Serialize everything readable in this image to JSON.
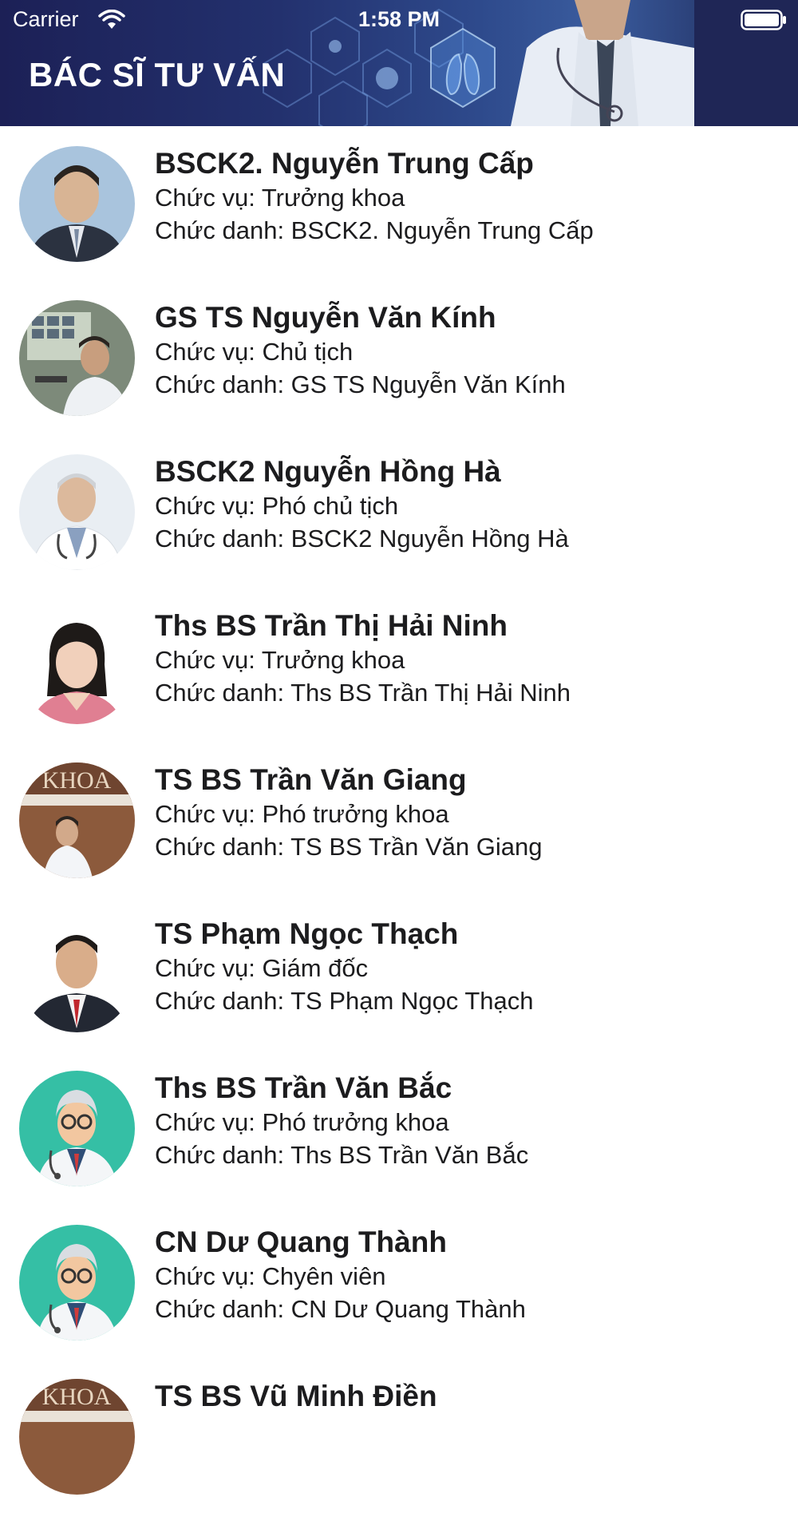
{
  "status_bar": {
    "carrier": "Carrier",
    "time": "1:58 PM"
  },
  "header": {
    "title": "BÁC SĨ TƯ VẤN"
  },
  "doctors": [
    {
      "name": "BSCK2. Nguyễn Trung Cấp",
      "position": "Chức vụ: Trưởng khoa",
      "title": "Chức danh: BSCK2. Nguyễn Trung Cấp"
    },
    {
      "name": "GS TS Nguyễn Văn Kính",
      "position": "Chức vụ: Chủ tịch",
      "title": "Chức danh: GS TS Nguyễn Văn Kính"
    },
    {
      "name": "BSCK2 Nguyễn Hồng Hà",
      "position": "Chức vụ: Phó chủ tịch",
      "title": "Chức danh: BSCK2 Nguyễn Hồng Hà"
    },
    {
      "name": "Ths BS Trần Thị Hải Ninh",
      "position": "Chức vụ: Trưởng khoa",
      "title": "Chức danh: Ths BS Trần Thị Hải Ninh"
    },
    {
      "name": "TS BS Trần Văn Giang",
      "position": "Chức vụ: Phó trưởng khoa",
      "title": "Chức danh: TS BS Trần Văn Giang"
    },
    {
      "name": "TS Phạm Ngọc Thạch",
      "position": "Chức vụ: Giám đốc",
      "title": "Chức danh: TS Phạm Ngọc Thạch"
    },
    {
      "name": "Ths BS Trần Văn Bắc",
      "position": "Chức vụ: Phó trưởng khoa",
      "title": "Chức danh: Ths BS Trần Văn Bắc"
    },
    {
      "name": "CN Dư Quang Thành",
      "position": "Chức vụ: Chyên viên",
      "title": "Chức danh: CN Dư Quang Thành"
    },
    {
      "name": "TS BS Vũ Minh Điền",
      "position": "",
      "title": ""
    }
  ],
  "avatar_images": [
    "doctor-photo",
    "doctor-photo",
    "doctor-photo",
    "doctor-photo",
    "doctor-photo",
    "doctor-photo",
    "doctor-avatar-illustration",
    "doctor-avatar-illustration",
    "doctor-photo"
  ],
  "colors": {
    "header_dark": "#1c2056",
    "header_accent": "#2e4a8c",
    "avatar_teal": "#35bfa5"
  }
}
